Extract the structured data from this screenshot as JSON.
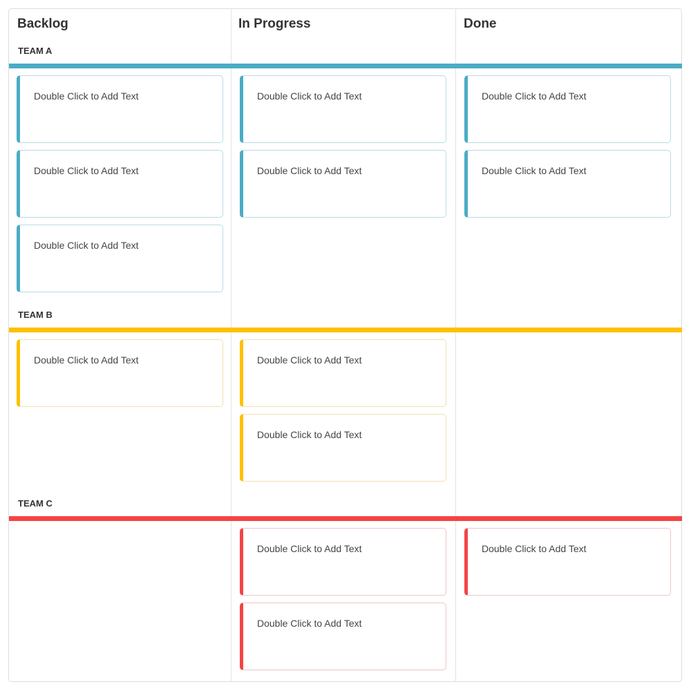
{
  "columns": [
    {
      "title": "Backlog"
    },
    {
      "title": "In Progress"
    },
    {
      "title": "Done"
    }
  ],
  "teams": [
    {
      "label": "TEAM A",
      "color": "#4bacc6",
      "card_border": "#b9dbe3",
      "cards": {
        "backlog": [
          "Double Click to Add Text",
          "Double Click to Add Text",
          "Double Click to Add Text"
        ],
        "in_progress": [
          "Double Click to Add Text",
          "Double Click to Add Text"
        ],
        "done": [
          "Double Click to Add Text",
          "Double Click to Add Text"
        ]
      }
    },
    {
      "label": "TEAM B",
      "color": "#ffc000",
      "card_border": "#f2e0b0",
      "cards": {
        "backlog": [
          "Double Click to Add Text"
        ],
        "in_progress": [
          "Double Click to Add Text",
          "Double Click to Add Text"
        ],
        "done": []
      }
    },
    {
      "label": "TEAM C",
      "color": "#f44444",
      "card_border": "#efc4c4",
      "cards": {
        "backlog": [],
        "in_progress": [
          "Double Click to Add Text",
          "Double Click to Add Text"
        ],
        "done": [
          "Double Click to Add Text"
        ]
      }
    }
  ]
}
